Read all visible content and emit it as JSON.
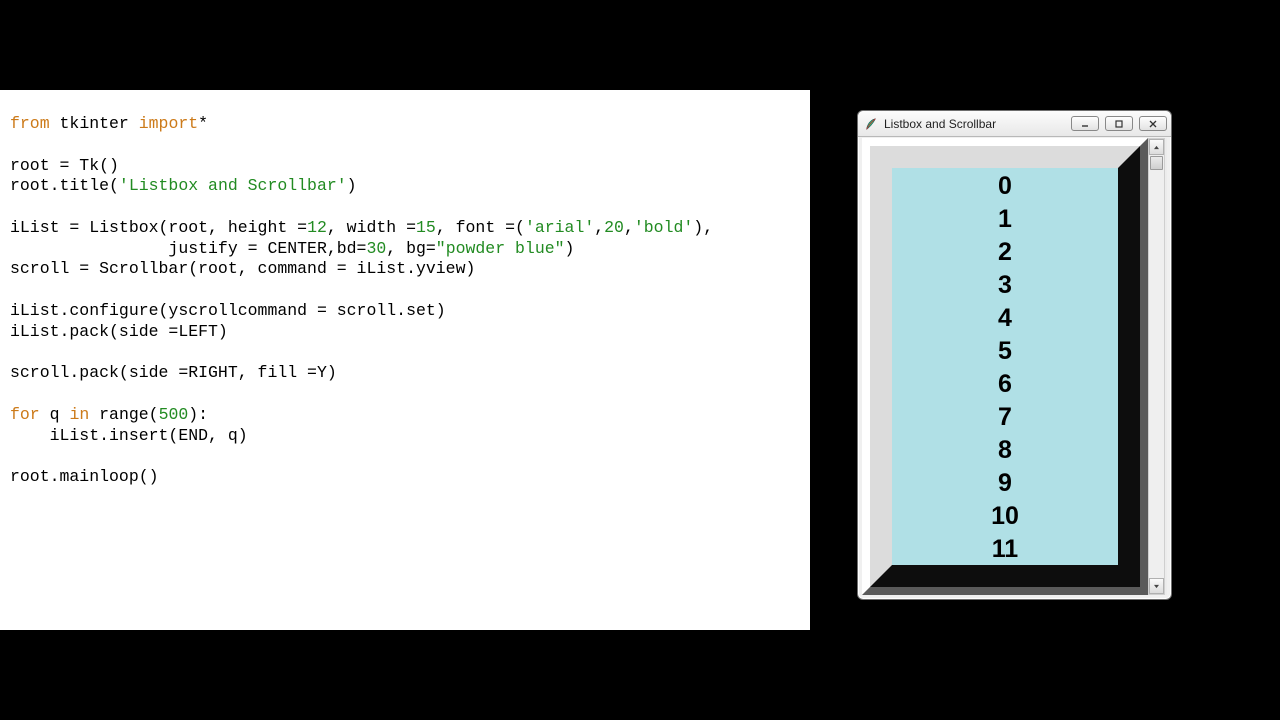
{
  "code": {
    "l1a": "from",
    "l1b": " tkinter ",
    "l1c": "import",
    "l1d": "*",
    "l2": "",
    "l3": "root = Tk()",
    "l4a": "root.title(",
    "l4b": "'Listbox and Scrollbar'",
    "l4c": ")",
    "l5": "",
    "l6a": "iList = Listbox(root, height =",
    "l6b": "12",
    "l6c": ", width =",
    "l6d": "15",
    "l6e": ", font =(",
    "l6f": "'arial'",
    "l6g": ",",
    "l6h": "20",
    "l6i": ",",
    "l6j": "'bold'",
    "l6k": "),",
    "l7a": "                justify = CENTER,bd=",
    "l7b": "30",
    "l7c": ", bg=",
    "l7d": "\"powder blue\"",
    "l7e": ")",
    "l8": "scroll = Scrollbar(root, command = iList.yview)",
    "l9": "",
    "l10": "iList.configure(yscrollcommand = scroll.set)",
    "l11": "iList.pack(side =LEFT)",
    "l12": "",
    "l13": "scroll.pack(side =RIGHT, fill =Y)",
    "l14": "",
    "l15a": "for",
    "l15b": " q ",
    "l15c": "in",
    "l15d": " range(",
    "l15e": "500",
    "l15f": "):",
    "l16": "    iList.insert(END, q)",
    "l17": "",
    "l18": "root.mainloop()"
  },
  "window": {
    "title": "Listbox and Scrollbar",
    "icon_name": "feather-icon",
    "buttons": {
      "min": "minimize-button",
      "max": "maximize-button",
      "close": "close-button"
    }
  },
  "listbox": {
    "items": [
      "0",
      "1",
      "2",
      "3",
      "4",
      "5",
      "6",
      "7",
      "8",
      "9",
      "10",
      "11"
    ],
    "bg": "#b0e0e6",
    "border_width": 30,
    "font_family": "arial",
    "font_size": 20,
    "font_weight": "bold",
    "justify": "center",
    "total_items": 500
  }
}
